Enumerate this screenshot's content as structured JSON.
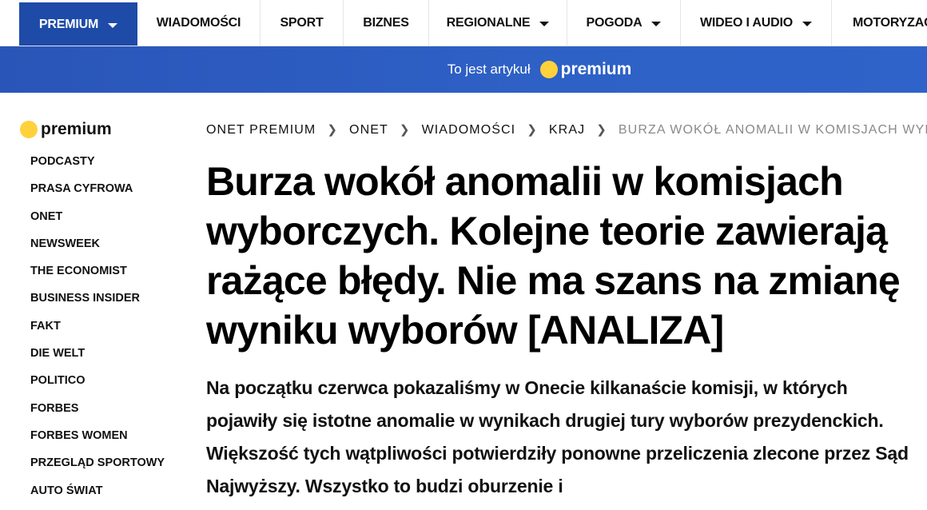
{
  "nav": {
    "items": [
      {
        "label": "PREMIUM",
        "dropdown": true,
        "active": true
      },
      {
        "label": "WIADOMOŚCI",
        "dropdown": false
      },
      {
        "label": "SPORT",
        "dropdown": false
      },
      {
        "label": "BIZNES",
        "dropdown": false
      },
      {
        "label": "REGIONALNE",
        "dropdown": true
      },
      {
        "label": "POGODA",
        "dropdown": true
      },
      {
        "label": "WIDEO I AUDIO",
        "dropdown": true
      },
      {
        "label": "MOTORYZACJA",
        "dropdown": false
      }
    ]
  },
  "banner": {
    "text": "To jest artykuł",
    "brand": "premium"
  },
  "sidebar": {
    "brand": "premium",
    "items": [
      "PODCASTY",
      "PRASA CYFROWA",
      "ONET",
      "NEWSWEEK",
      "THE ECONOMIST",
      "BUSINESS INSIDER",
      "FAKT",
      "DIE WELT",
      "POLITICO",
      "FORBES",
      "FORBES WOMEN",
      "PRZEGLĄD SPORTOWY",
      "AUTO ŚWIAT"
    ]
  },
  "breadcrumb": [
    "ONET PREMIUM",
    "ONET",
    "WIADOMOŚCI",
    "KRAJ",
    "BURZA WOKÓŁ ANOMALII W KOMISJACH WYBORCZYCH"
  ],
  "article": {
    "title": "Burza wokół anomalii w komisjach wyborczych. Kolejne teorie zawierają rażące błędy. Nie ma szans na zmianę wyniku wyborów [ANALIZA]",
    "lead": "Na początku czerwca pokazaliśmy w Onecie kilkanaście komisji, w których pojawiły się istotne anomalie w wynikach drugiej tury wyborów prezydenckich. Większość tych wątpliwości potwierdziły ponowne przeliczenia zlecone przez Sąd Najwyższy. Wszystko to budzi oburzenie i"
  },
  "colors": {
    "nav_active": "#1e4ba8",
    "banner": "#2e5fc5",
    "premium_dot": "#ffd23c"
  }
}
